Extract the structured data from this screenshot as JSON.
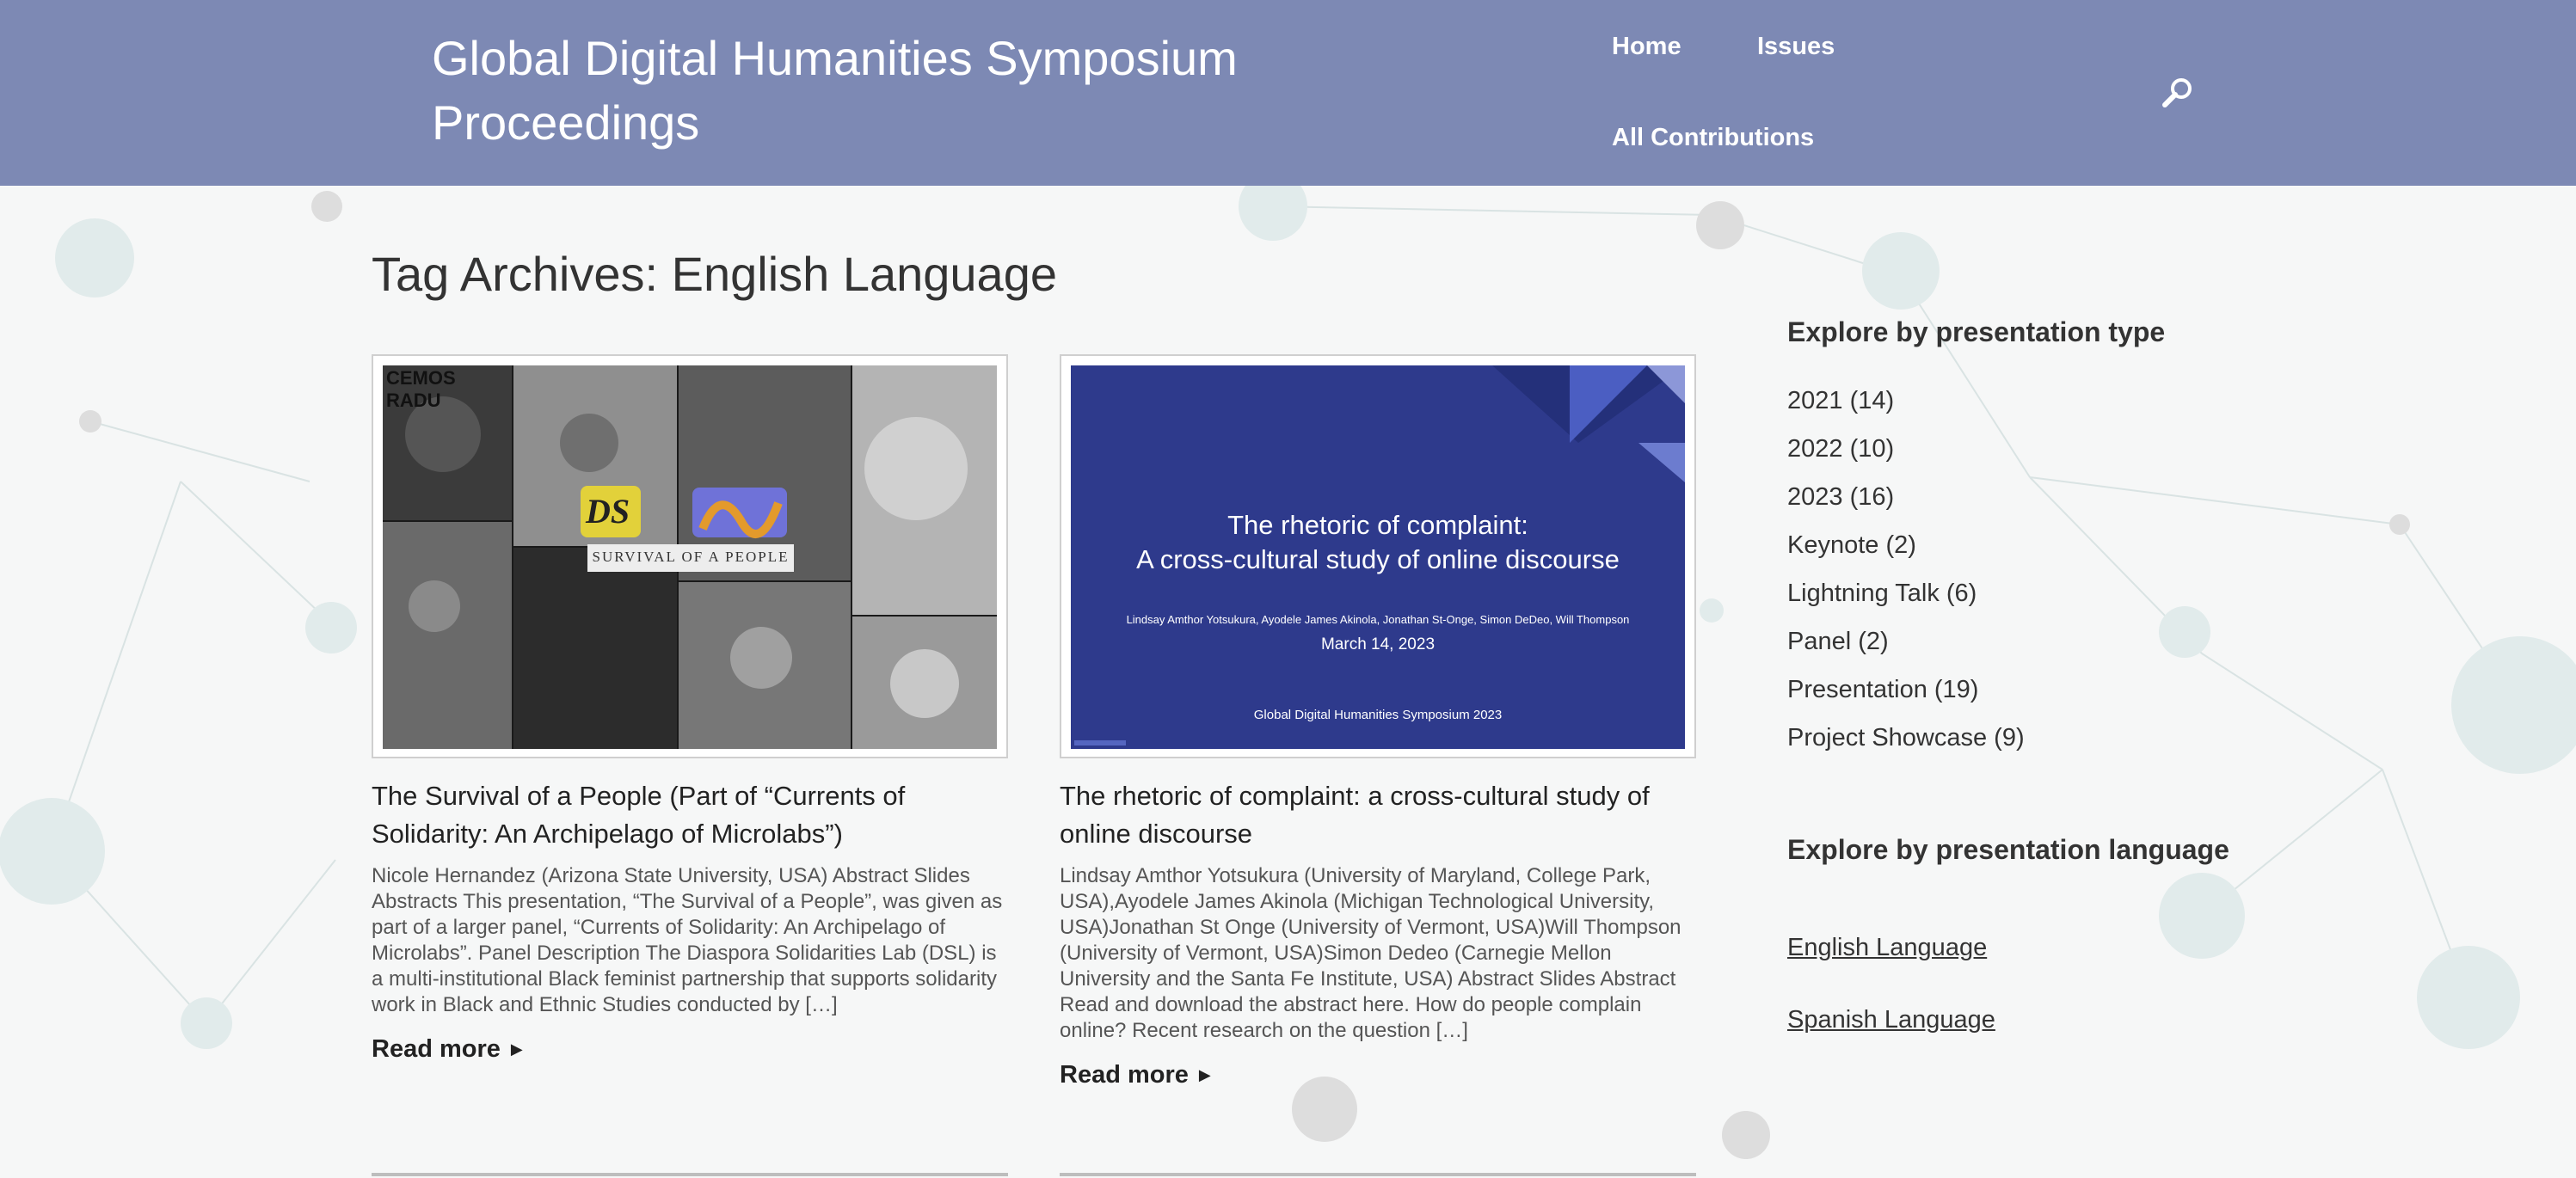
{
  "header": {
    "site_title": "Global Digital Humanities Symposium Proceedings",
    "nav": {
      "home": "Home",
      "issues": "Issues",
      "all_contributions": "All Contributions"
    },
    "bg_color": "#7d89b4",
    "search_icon": "search-icon"
  },
  "archive": {
    "title": "Tag Archives: English Language"
  },
  "posts": [
    {
      "title": "The Survival of a People (Part of “Currents of Solidarity: An Archipelago of Microlabs”)",
      "excerpt": "Nicole Hernandez (Arizona State University, USA) Abstract Slides Abstracts This presentation, “The Survival of a People”, was given as part of a larger panel, “Currents of Solidarity: An Archipelago of Microlabs”. Panel Description The Diaspora Solidarities Lab (DSL) is a multi-institutional Black feminist partnership that supports solidarity work in Black and Ethnic Studies conducted by […]",
      "read_more": "Read more",
      "thumb": {
        "banner": "SURVIVAL OF A PEOPLE",
        "logo": "DS",
        "corner_text": "CEMOS RADU"
      }
    },
    {
      "title": "The rhetoric of complaint: a cross-cultural study of online discourse",
      "excerpt": "Lindsay Amthor Yotsukura (University of Maryland, College Park, USA),Ayodele James Akinola (Michigan Technological University, USA)Jonathan St Onge (University of Vermont, USA)Will Thompson (University of Vermont, USA)Simon Dedeo (Carnegie Mellon University and the Santa Fe Institute, USA) Abstract Slides Abstract Read and download the abstract here. How do people complain online? Recent research on the question […]",
      "read_more": "Read more",
      "thumb": {
        "line1": "The rhetoric of complaint:",
        "line2": "A cross-cultural study of online discourse",
        "authors": "Lindsay Amthor Yotsukura, Ayodele James Akinola, Jonathan St-Onge, Simon DeDeo, Will Thompson",
        "date": "March 14, 2023",
        "footer": "Global Digital Humanities Symposium 2023"
      }
    }
  ],
  "sidebar": {
    "type_title": "Explore by presentation type",
    "types": [
      "2021 (14)",
      "2022 (10)",
      "2023 (16)",
      "Keynote (2)",
      "Lightning Talk (6)",
      "Panel (2)",
      "Presentation (19)",
      "Project Showcase (9)"
    ],
    "language_title": "Explore by presentation language",
    "languages": [
      "English Language",
      "Spanish Language"
    ]
  },
  "colors": {
    "slide_bg": "#2e3a8c",
    "accent_triangle": "#3e4fb0",
    "page_bg": "#f6f7f7"
  }
}
